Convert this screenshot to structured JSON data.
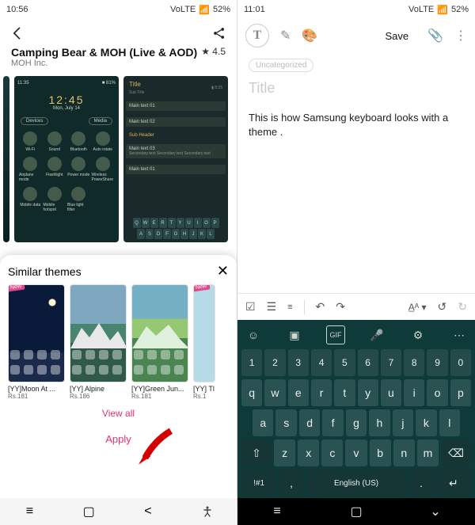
{
  "left": {
    "status": {
      "time": "10:56",
      "net": "VoLTE",
      "sig": "⫶",
      "bat": "52%"
    },
    "header": {},
    "title": "Camping Bear & MOH (Live & AOD)",
    "publisher": "MOH Inc.",
    "rating": "★ 4.5",
    "shot2": {
      "clock": "12:45",
      "date": "Mon, July 14",
      "devices": "Devices",
      "media": "Media",
      "icons": [
        "Wi-Fi",
        "Sound",
        "Bluetooth",
        "Auto rotate",
        "Airplane mode",
        "Flashlight",
        "Power mode",
        "Wireless PowerShare",
        "Mobile data",
        "Mobile hotspot",
        "Blue light filter",
        ""
      ]
    },
    "shot3": {
      "title": "Title",
      "sub": "Sub Title",
      "m1": "Main text 01",
      "m2": "Main text 02",
      "sh": "Sub Header",
      "m3": "Main text 03",
      "sec": "Secondary text Secondary text Secondary text",
      "m4": "Main text 01",
      "kb_r1": [
        "Q",
        "W",
        "E",
        "R",
        "T",
        "Y",
        "U",
        "I",
        "O",
        "P"
      ],
      "kb_r2": [
        "A",
        "S",
        "D",
        "F",
        "G",
        "H",
        "J",
        "K",
        "L"
      ]
    },
    "similar": {
      "heading": "Similar themes",
      "themes": [
        {
          "name": "[YY]Moon At ...",
          "price": "Rs.181",
          "new": true
        },
        {
          "name": "[YY] Alpine",
          "price": "Rs.186",
          "new": false
        },
        {
          "name": "[YY]Green Jun...",
          "price": "Rs.181",
          "new": false
        },
        {
          "name": "[YY] Tl",
          "price": "Rs.1",
          "new": true
        }
      ],
      "viewall": "View all",
      "apply": "Apply"
    }
  },
  "right": {
    "status": {
      "time": "11:01",
      "net": "VoLTE",
      "bat": "52%"
    },
    "save": "Save",
    "uncat": "Uncategorized",
    "title_ph": "Title",
    "body": "This is how Samsung keyboard looks with a theme .",
    "kb": {
      "nums": [
        "1",
        "2",
        "3",
        "4",
        "5",
        "6",
        "7",
        "8",
        "9",
        "0"
      ],
      "r1": [
        "q",
        "w",
        "e",
        "r",
        "t",
        "y",
        "u",
        "i",
        "o",
        "p"
      ],
      "r2": [
        "a",
        "s",
        "d",
        "f",
        "g",
        "h",
        "j",
        "k",
        "l"
      ],
      "shift": "⇧",
      "r3": [
        "z",
        "x",
        "c",
        "v",
        "b",
        "n",
        "m"
      ],
      "bksp": "⌫",
      "sym": "!#1",
      "comma": ",",
      "lang": "English (US)",
      "dot": ".",
      "ret": "↵"
    }
  }
}
